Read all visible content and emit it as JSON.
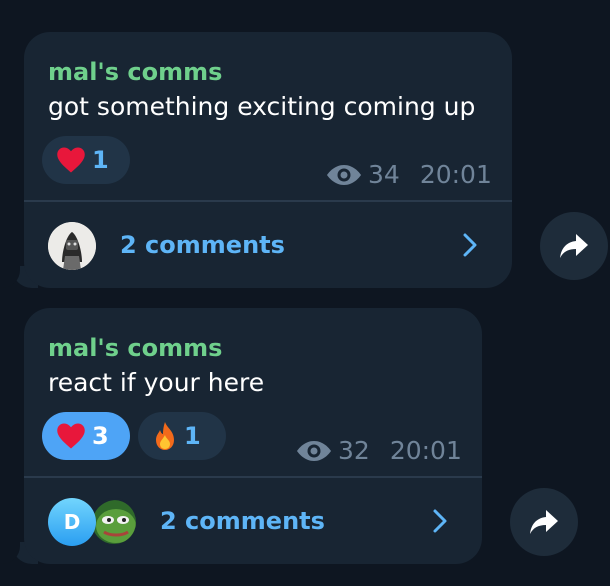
{
  "messages": [
    {
      "sender": "mal's comms",
      "text": "got something exciting coming up",
      "reactions": [
        {
          "emoji": "heart",
          "count": "1"
        }
      ],
      "views": "34",
      "time": "20:01",
      "comments": "2 comments"
    },
    {
      "sender": "mal's comms",
      "text": "react if your here",
      "reactions": [
        {
          "emoji": "heart",
          "count": "3"
        },
        {
          "emoji": "fire",
          "count": "1"
        }
      ],
      "views": "32",
      "time": "20:01",
      "comments": "2 comments",
      "avatar_letter": "D"
    }
  ],
  "icons": {
    "views": "eye-icon",
    "share": "share-arrow-icon",
    "chevron": "chevron-right-icon",
    "heart": "heart-icon",
    "fire": "fire-icon"
  },
  "colors": {
    "background": "#0e1621",
    "bubble": "#182533",
    "sender": "#6fd08c",
    "accent": "#5eb5f7",
    "active_reaction": "#4ea4f6",
    "meta": "#708499"
  }
}
